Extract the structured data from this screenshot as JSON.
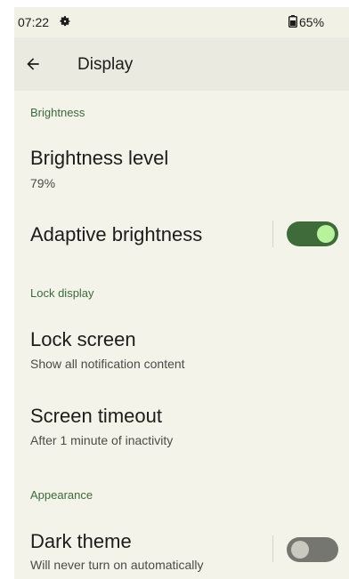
{
  "status_bar": {
    "time": "07:22",
    "left_icon": "gear-icon",
    "battery_icon": "battery-icon",
    "battery": "65%"
  },
  "app_bar": {
    "back_icon": "back-arrow-icon",
    "title": "Display"
  },
  "sections": [
    {
      "header": "Brightness",
      "items": [
        {
          "title": "Brightness level",
          "subtitle": "79%"
        },
        {
          "title": "Adaptive brightness",
          "toggle": true
        }
      ]
    },
    {
      "header": "Lock display",
      "items": [
        {
          "title": "Lock screen",
          "subtitle": "Show all notification content"
        },
        {
          "title": "Screen timeout",
          "subtitle": "After 1 minute of inactivity"
        }
      ]
    },
    {
      "header": "Appearance",
      "items": [
        {
          "title": "Dark theme",
          "subtitle": "Will never turn on automatically",
          "toggle": false
        }
      ]
    }
  ],
  "colors": {
    "background": "#f4f3ea",
    "app_bar": "#eaeae0",
    "accent": "#3f6b3b",
    "toggle_on_knob": "#b9f29c",
    "toggle_off": "#767670",
    "section_header": "#3c6a3a"
  }
}
